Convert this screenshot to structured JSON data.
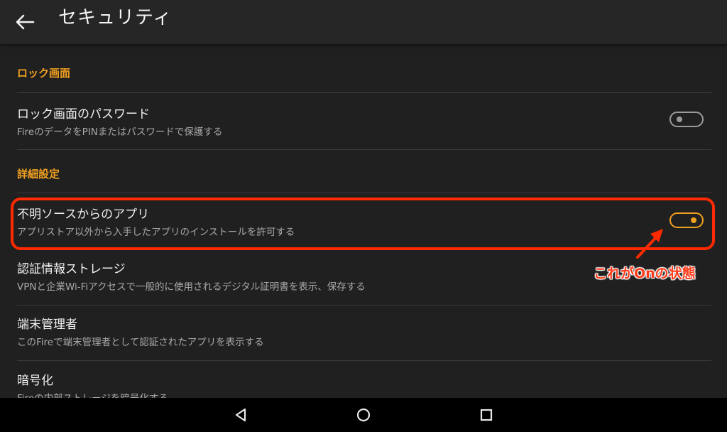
{
  "header": {
    "title": "セキュリティ",
    "back_icon": "arrow-left-icon"
  },
  "sections": [
    {
      "header": "ロック画面",
      "items": [
        {
          "title": "ロック画面のパスワード",
          "subtitle": "FireのデータをPINまたはパスワードで保護する",
          "toggle": "off"
        }
      ]
    },
    {
      "header": "詳細設定",
      "items": [
        {
          "title": "不明ソースからのアプリ",
          "subtitle": "アプリストア以外から入手したアプリのインストールを許可する",
          "toggle": "on"
        },
        {
          "title": "認証情報ストレージ",
          "subtitle": "VPNと企業Wi-Fiアクセスで一般的に使用されるデジタル証明書を表示、保存する"
        },
        {
          "title": "端末管理者",
          "subtitle": "このFireで端末管理者として認証されたアプリを表示する"
        },
        {
          "title": "暗号化",
          "subtitle": "Fireの内部ストレージを暗号化する"
        }
      ]
    }
  ],
  "annotation": {
    "text": "これがOnの状態"
  },
  "navbar": {
    "back_icon": "triangle-back-icon",
    "home_icon": "circle-home-icon",
    "recents_icon": "square-recents-icon"
  },
  "colors": {
    "accent": "#f0a020",
    "annotation": "#ff2a00",
    "background": "#202020",
    "topbar": "#262626"
  }
}
